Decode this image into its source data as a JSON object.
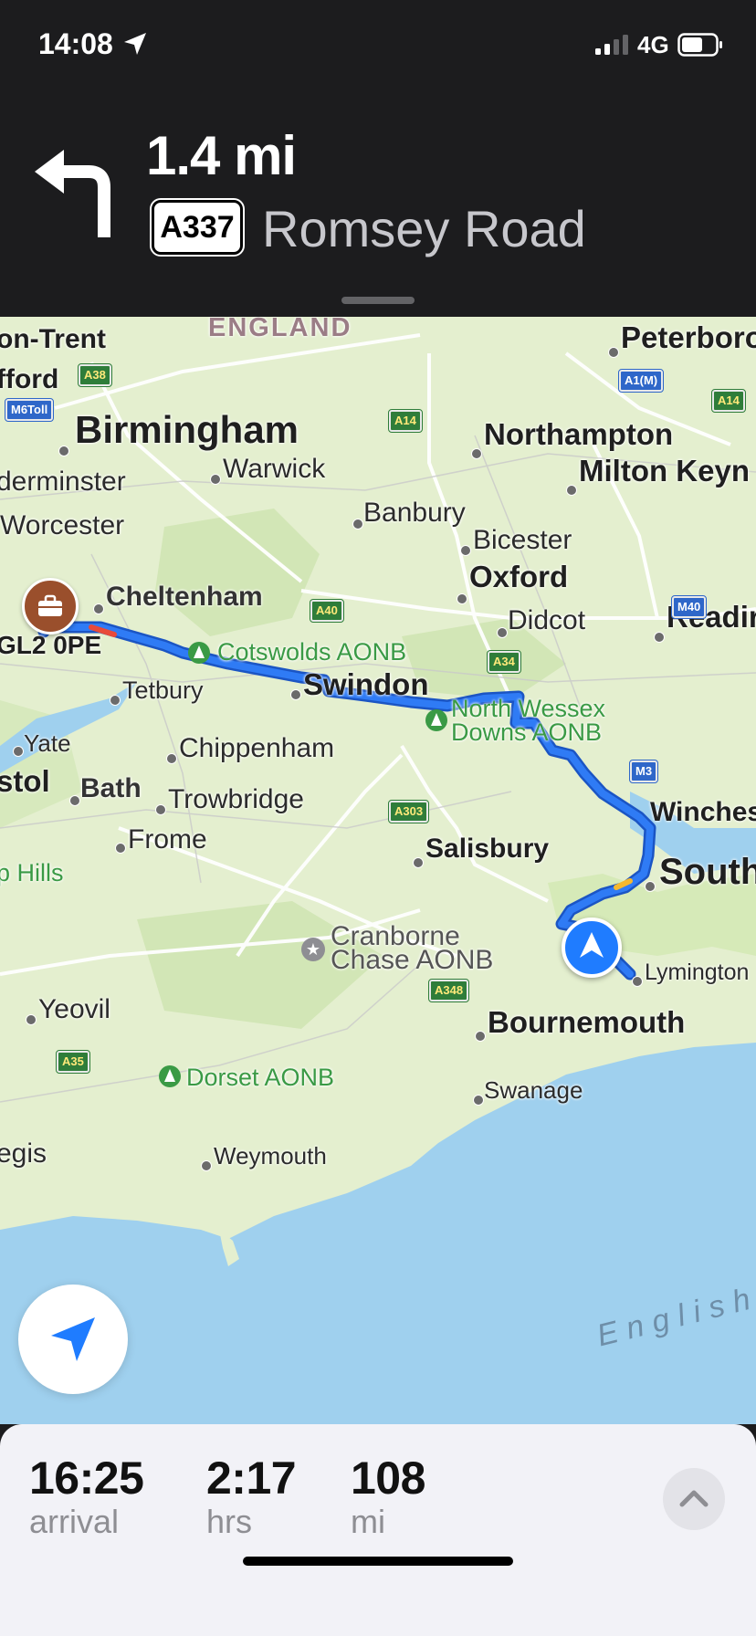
{
  "status_bar": {
    "time": "14:08",
    "network": "4G"
  },
  "instruction": {
    "distance": "1.4 mi",
    "road_number": "A337",
    "road_name": "Romsey Road",
    "maneuver_icon": "turn-left-icon"
  },
  "map": {
    "region": "ENGLAND",
    "sea_label": "English",
    "places": {
      "on_trent": "on-Trent",
      "fford": "fford",
      "peterborough": "Peterboro",
      "birmingham": "Birmingham",
      "northampton": "Northampton",
      "warwick": "Warwick",
      "milton_keynes": "Milton Keyn",
      "kidderminster": "derminster",
      "banbury": "Banbury",
      "worcester": "Worcester",
      "bicester": "Bicester",
      "oxford": "Oxford",
      "cheltenham": "Cheltenham",
      "didcot": "Didcot",
      "reading": "Readir",
      "destination_postcode": "GL2 0PE",
      "cotswolds": "Cotswolds AONB",
      "tetbury": "Tetbury",
      "swindon": "Swindon",
      "north_wessex_1": "North Wessex",
      "north_wessex_2": "Downs AONB",
      "yate": "Yate",
      "chippenham": "Chippenham",
      "bristol": "stol",
      "bath": "Bath",
      "trowbridge": "Trowbridge",
      "winchester": "Winches",
      "frome": "Frome",
      "mendip_hills": "p Hills",
      "salisbury": "Salisbury",
      "southampton": "South",
      "cranborne_1": "Cranborne",
      "cranborne_2": "Chase AONB",
      "lymington": "Lymington",
      "yeovil": "Yeovil",
      "bournemouth": "Bournemouth",
      "dorset": "Dorset AONB",
      "swanage": "Swanage",
      "regis": "egis",
      "weymouth": "Weymouth"
    },
    "road_shields": {
      "a38": "A38",
      "m6toll": "M6Toll",
      "a14_1": "A14",
      "a1m": "A1(M)",
      "a14_2": "A14",
      "a40": "A40",
      "m40": "M40",
      "a34": "A34",
      "m3": "M3",
      "a303": "A303",
      "a348": "A348",
      "a35": "A35"
    }
  },
  "trip": {
    "arrival_value": "16:25",
    "arrival_unit": "arrival",
    "duration_value": "2:17",
    "duration_unit": "hrs",
    "distance_value": "108",
    "distance_unit": "mi"
  },
  "colors": {
    "route": "#2f7bf5",
    "land": "#e4efcf",
    "sea": "#9fd0ee",
    "banner": "#1c1c1e"
  }
}
